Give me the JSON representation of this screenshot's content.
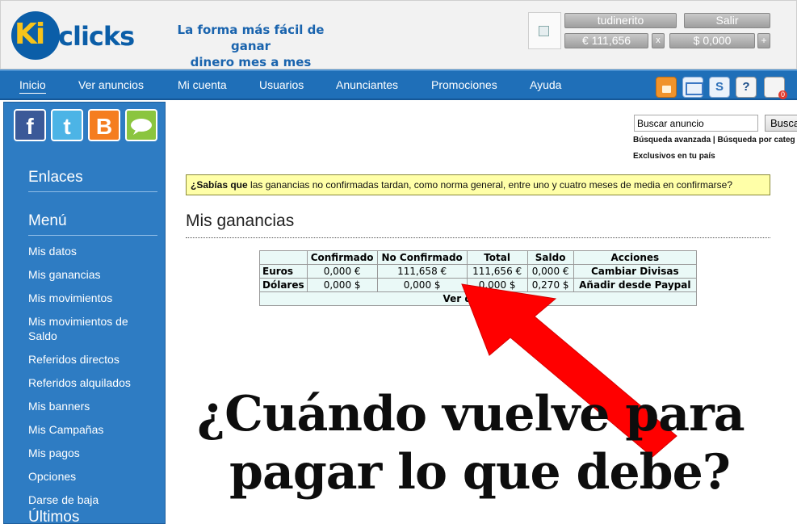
{
  "brand": {
    "logo_ki": "Ki",
    "logo_clicks": "clicks",
    "slogan_line1": "La forma más fácil de ganar",
    "slogan_line2": "dinero mes a mes"
  },
  "header": {
    "username": "tudinerito",
    "logout": "Salir",
    "balance_eur": "€ 111,656",
    "balance_eur_action": "x",
    "balance_usd": "$ 0,000",
    "balance_usd_action": "+"
  },
  "nav": {
    "items": [
      "Inicio",
      "Ver anuncios",
      "Mi cuenta",
      "Usuarios",
      "Anunciantes",
      "Promociones",
      "Ayuda"
    ],
    "active": "Inicio",
    "icons": [
      "lock-icon",
      "mail-icon",
      "skype-icon",
      "help-icon",
      "cart-icon"
    ],
    "help_glyph": "?",
    "skype_glyph": "S",
    "cart_badge": "0"
  },
  "social": {
    "facebook": "f",
    "twitter": "t",
    "blogger": "B"
  },
  "sidebar": {
    "enlaces": "Enlaces",
    "menu": "Menú",
    "items": [
      "Mis datos",
      "Mis ganancias",
      "Mis movimientos",
      "Mis movimientos de Saldo",
      "Referidos directos",
      "Referidos alquilados",
      "Mis banners",
      "Mis Campañas",
      "Mis pagos",
      "Opciones",
      "Darse de baja"
    ],
    "ultimos": "Últimos"
  },
  "search": {
    "value": "Buscar anuncio",
    "button": "Busca",
    "advanced": "Búsqueda avanzada",
    "separator": " | ",
    "by_category": "Búsqueda por categ",
    "exclusive": "Exclusivos en tu país"
  },
  "tip": {
    "lead": "¿Sabías que",
    "text": " las ganancias no confirmadas tardan, como norma general, entre uno y cuatro meses de media en confirmarse?"
  },
  "page": {
    "title": "Mis ganancias"
  },
  "earnings_table": {
    "headers": [
      "",
      "Confirmado",
      "No Confirmado",
      "Total",
      "Saldo",
      "Acciones"
    ],
    "rows": [
      {
        "label": "Euros",
        "confirmado": "0,000 €",
        "no_confirmado": "111,658 €",
        "total": "111,656 €",
        "saldo": "0,000 €",
        "accion": "Cambiar Divisas"
      },
      {
        "label": "Dólares",
        "confirmado": "0,000 $",
        "no_confirmado": "0,000 $",
        "total": "0,000 $",
        "saldo": "0,270 $",
        "accion": "Añadir desde Paypal"
      }
    ],
    "footer": "Ver desglose"
  },
  "overlay": {
    "line1": "¿Cuándo vuelve para",
    "line2": "pagar lo que debe?",
    "arrow_color": "#ff0000"
  },
  "colors": {
    "nav": "#1f6fb8",
    "sidebar": "#2e7cc3",
    "brand_blue": "#0b5ea8",
    "brand_yellow": "#f7c31a",
    "tip_bg": "#ffffa8",
    "table_bg": "#eaf9f7"
  }
}
